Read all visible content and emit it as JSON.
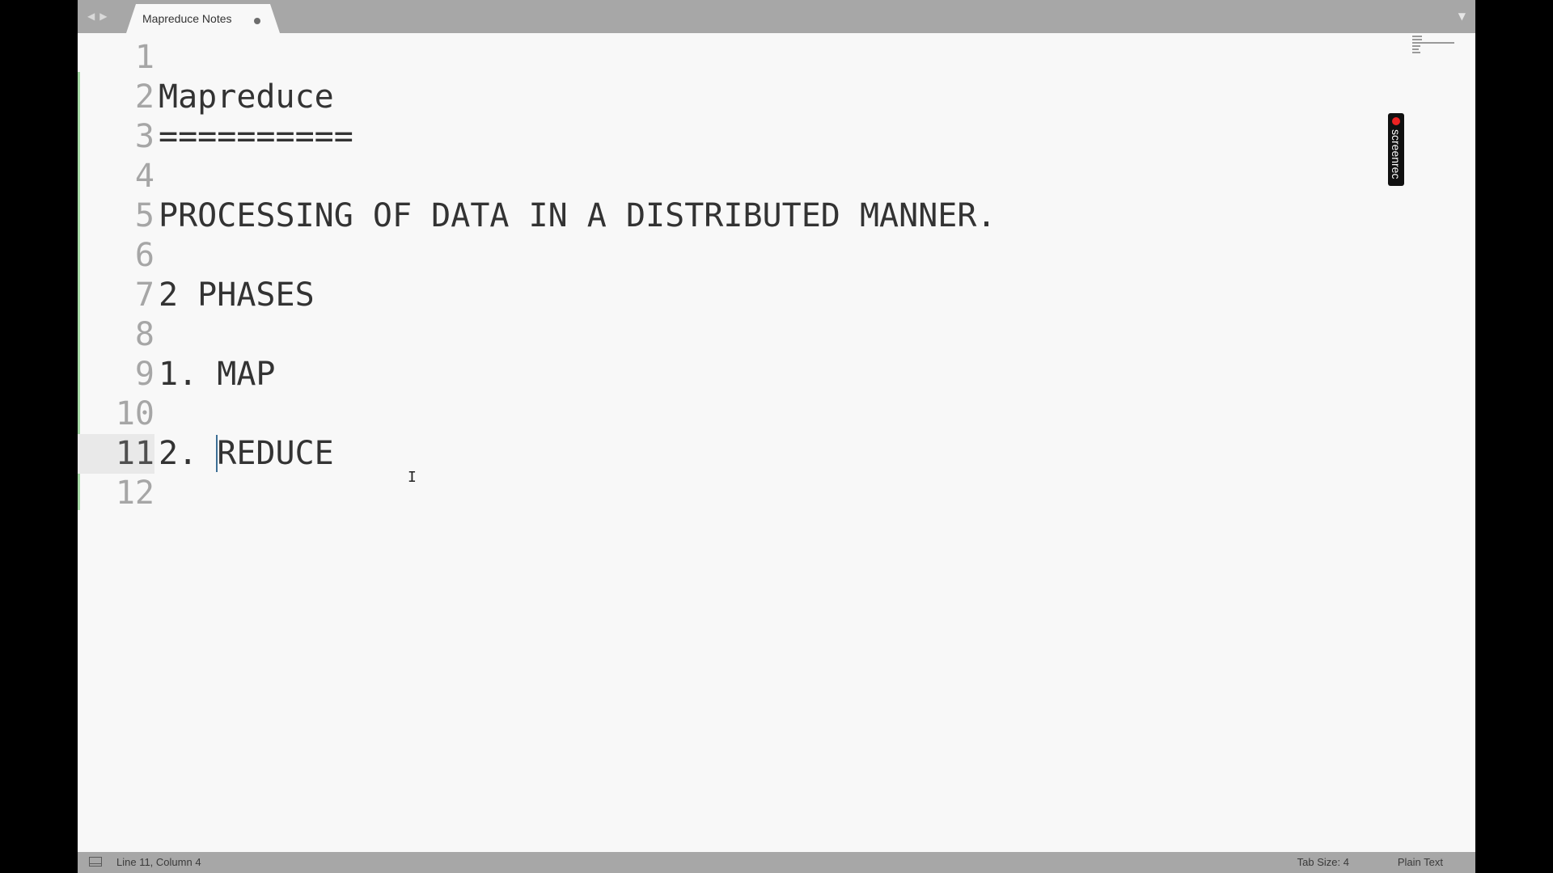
{
  "tabbar": {
    "back_icon": "arrow-left-icon",
    "forward_icon": "arrow-right-icon",
    "tab_title": "Mapreduce Notes",
    "overflow_icon": "chevron-down-icon"
  },
  "editor": {
    "lines": [
      {
        "number": "1",
        "text": ""
      },
      {
        "number": "2",
        "text": "Mapreduce"
      },
      {
        "number": "3",
        "text": "=========="
      },
      {
        "number": "4",
        "text": ""
      },
      {
        "number": "5",
        "text": "PROCESSING OF DATA IN A DISTRIBUTED MANNER."
      },
      {
        "number": "6",
        "text": ""
      },
      {
        "number": "7",
        "text": "2 PHASES"
      },
      {
        "number": "8",
        "text": ""
      },
      {
        "number": "9",
        "text": "1. MAP"
      },
      {
        "number": "10",
        "text": ""
      },
      {
        "number": "11",
        "text_before_caret": "2. ",
        "text_after_caret": "REDUCE"
      },
      {
        "number": "12",
        "text": ""
      }
    ],
    "active_line": 11
  },
  "overlay": {
    "recorder_label": "screenrec"
  },
  "statusbar": {
    "position": "Line 11, Column 4",
    "tab_size": "Tab Size: 4",
    "syntax": "Plain Text"
  },
  "colors": {
    "tab_bar": "#a7a7a7",
    "editor_bg": "#f8f8f8",
    "gutter_text": "#a6a6a6",
    "code_text": "#333333",
    "caret": "#3d6f95",
    "modified_marker": "#a6d9a6"
  }
}
